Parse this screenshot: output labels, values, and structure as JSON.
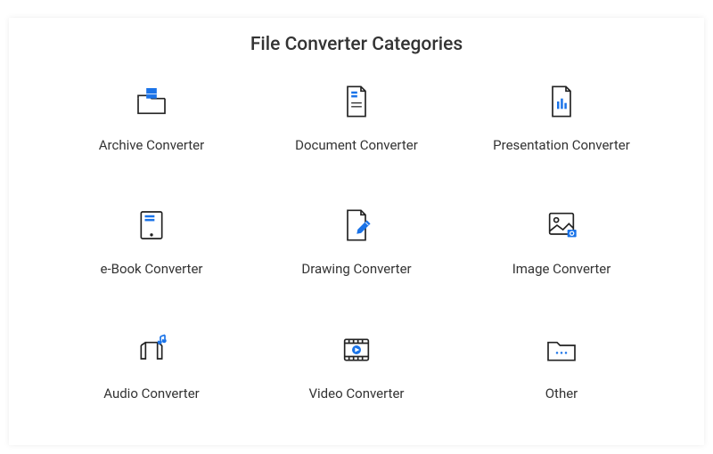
{
  "title": "File Converter Categories",
  "categories": [
    {
      "label": "Archive Converter",
      "icon": "archive-icon"
    },
    {
      "label": "Document Converter",
      "icon": "document-icon"
    },
    {
      "label": "Presentation Converter",
      "icon": "presentation-icon"
    },
    {
      "label": "e-Book Converter",
      "icon": "ebook-icon"
    },
    {
      "label": "Drawing Converter",
      "icon": "drawing-icon"
    },
    {
      "label": "Image Converter",
      "icon": "image-icon"
    },
    {
      "label": "Audio Converter",
      "icon": "audio-icon"
    },
    {
      "label": "Video Converter",
      "icon": "video-icon"
    },
    {
      "label": "Other",
      "icon": "other-icon"
    }
  ],
  "colors": {
    "accent": "#1a73e8",
    "stroke": "#222"
  }
}
